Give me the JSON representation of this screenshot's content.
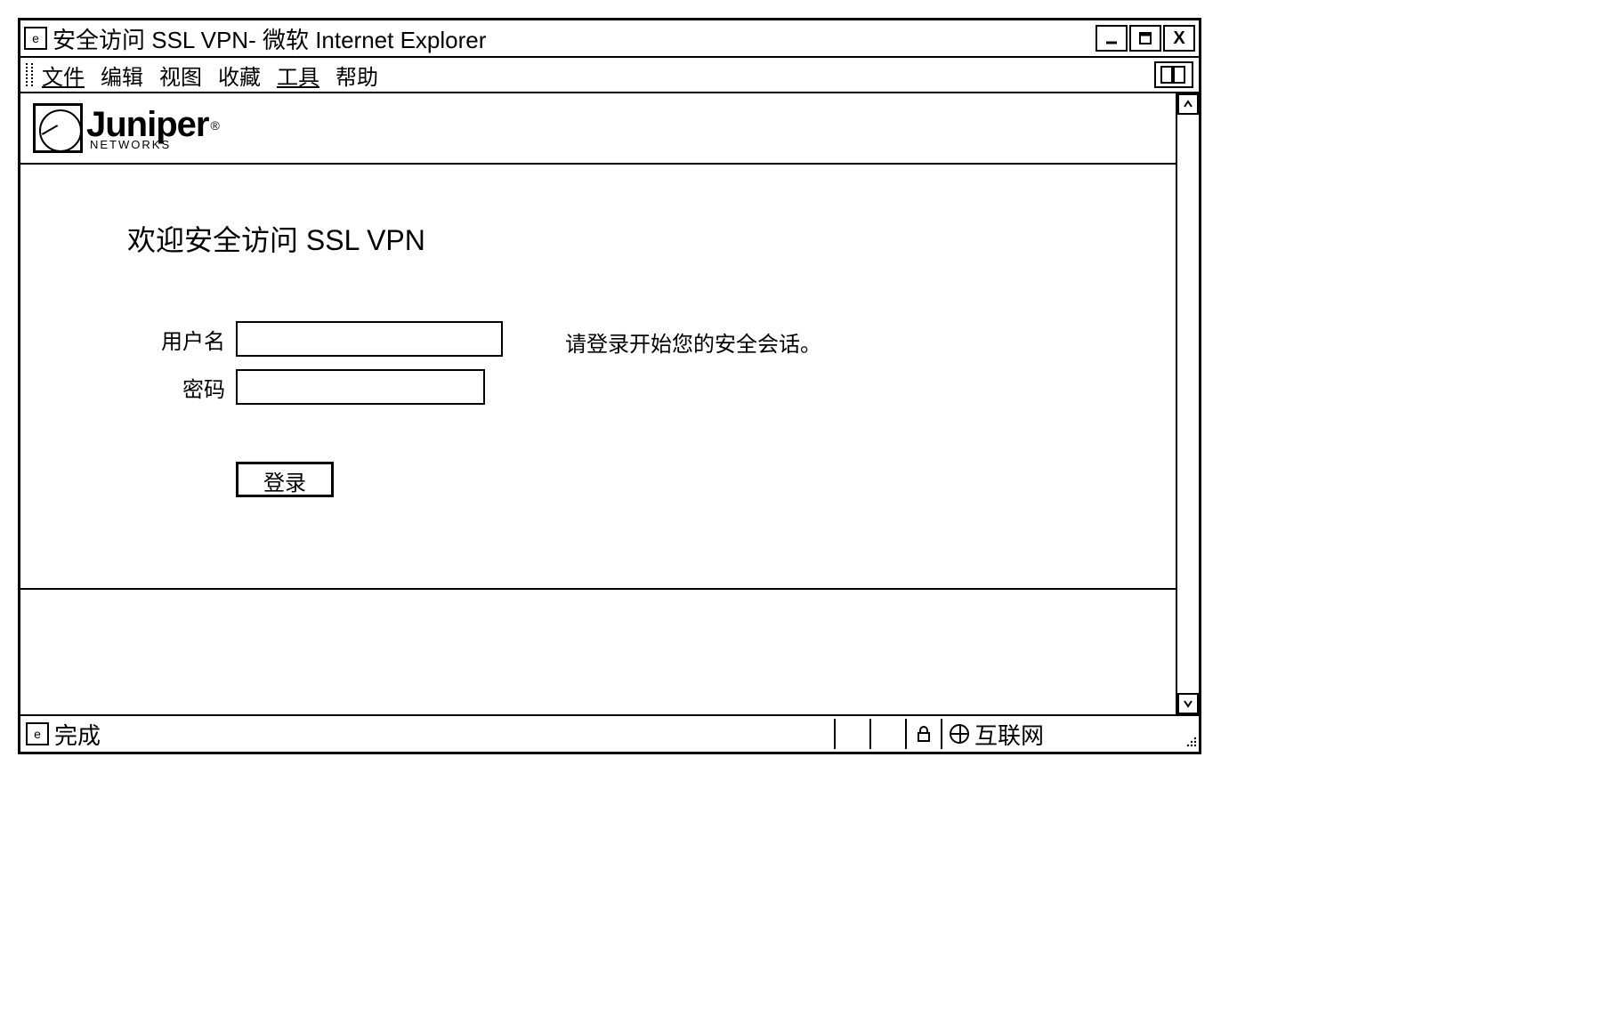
{
  "window": {
    "title": "安全访问 SSL VPN- 微软 Internet Explorer",
    "minimize": "_",
    "maximize": "❐",
    "close": "X"
  },
  "menu": {
    "file": "文件",
    "edit": "编辑",
    "view": "视图",
    "favorites": "收藏",
    "tools": "工具",
    "help": "帮助"
  },
  "brand": {
    "name": "Juniper",
    "reg": "®",
    "sub": "NETWORKS"
  },
  "page": {
    "welcome": "欢迎安全访问 SSL VPN",
    "username_label": "用户名",
    "password_label": "密码",
    "username_value": "",
    "password_value": "",
    "hint": "请登录开始您的安全会话。",
    "login": "登录"
  },
  "status": {
    "text": "完成",
    "zone": "互联网"
  }
}
